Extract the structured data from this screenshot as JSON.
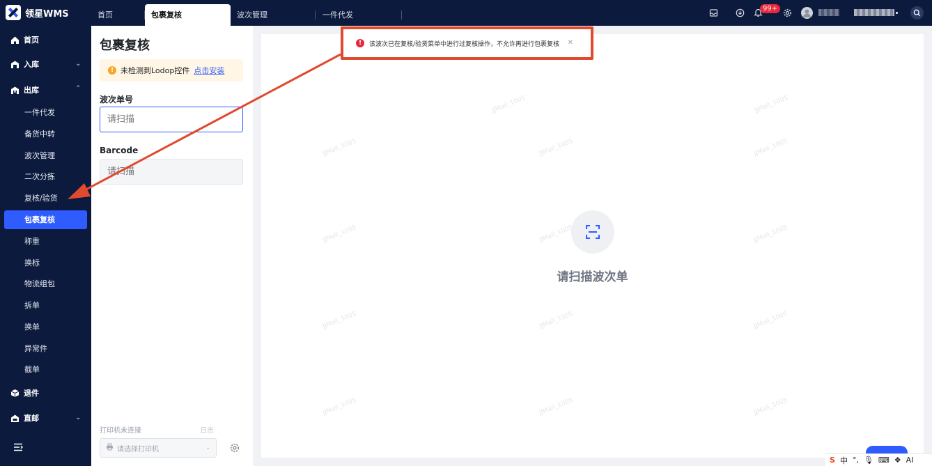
{
  "app": {
    "name": "领星WMS"
  },
  "tabs": [
    {
      "label": "首页"
    },
    {
      "label": "包裹复核"
    },
    {
      "label": "波次管理"
    },
    {
      "label": "一件代发"
    }
  ],
  "header": {
    "notification_badge": "99+"
  },
  "sidebar": {
    "groups": [
      {
        "label": "首页",
        "icon": "home-icon"
      },
      {
        "label": "入库",
        "icon": "warehouse-in-icon"
      },
      {
        "label": "出库",
        "icon": "warehouse-out-icon"
      },
      {
        "label": "退件",
        "icon": "return-box-icon"
      },
      {
        "label": "直邮",
        "icon": "direct-mail-icon"
      }
    ],
    "outbound_items": [
      "一件代发",
      "备货中转",
      "波次管理",
      "二次分拣",
      "复核/验货",
      "包裹复核",
      "称重",
      "换标",
      "物流组包",
      "拆单",
      "换单",
      "异常件",
      "截单"
    ],
    "active_item": "包裹复核"
  },
  "panel": {
    "title": "包裹复核",
    "alert_text": "未检测到Lodop控件",
    "alert_link": "点击安装",
    "wave_label": "波次单号",
    "wave_placeholder": "请扫描",
    "barcode_label": "Barcode",
    "barcode_placeholder": "请扫描",
    "printer_status": "打印机未连接",
    "log_link": "日志",
    "printer_placeholder": "请选择打印机"
  },
  "main": {
    "scan_prompt": "请扫描波次单"
  },
  "toast": {
    "message": "该波次已在复核/验货菜单中进行过复核操作，不允许再进行包裹复核",
    "type": "error"
  },
  "watermark": {
    "text": "JJMall_1005"
  },
  "tray": {
    "ime": "中",
    "label_ai": "AI"
  },
  "colors": {
    "nav_bg": "#0c1a3d",
    "accent": "#2f5cff",
    "error": "#e5293b",
    "warning": "#f5a623",
    "annotation": "#e04a2f"
  }
}
